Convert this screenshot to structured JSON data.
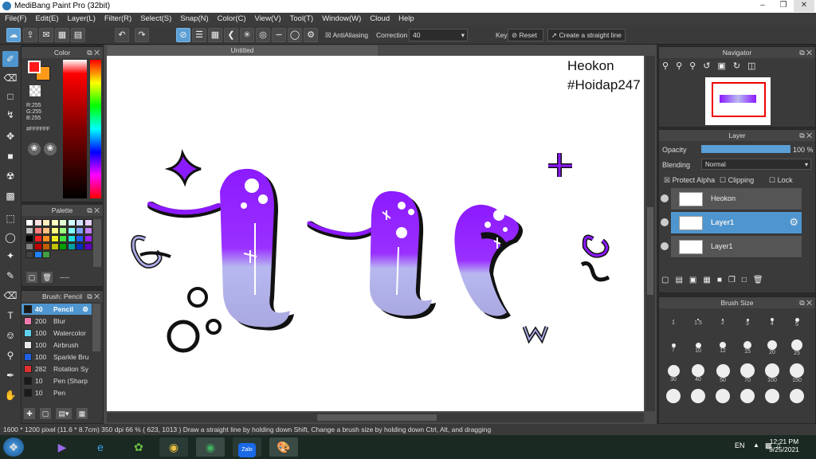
{
  "window": {
    "title": "MediBang Paint Pro (32bit)"
  },
  "menu": [
    "File(F)",
    "Edit(E)",
    "Layer(L)",
    "Filter(R)",
    "Select(S)",
    "Snap(N)",
    "Color(C)",
    "View(V)",
    "Tool(T)",
    "Window(W)",
    "Cloud",
    "Help"
  ],
  "toolbar": {
    "antialiasing": "AntiAliasing",
    "correction_label": "Correction",
    "correction_value": "40",
    "key_label": "Key",
    "reset_label": "Reset",
    "straight_line_label": "Create a straight line"
  },
  "color_panel": {
    "title": "Color",
    "r": "R:255",
    "g": "G:255",
    "b": "B:255",
    "hex": "#FFFFFF",
    "fg": "#ff1a1a",
    "bg": "#ff9a1a"
  },
  "palette_panel": {
    "title": "Palette",
    "page": "----"
  },
  "brush_panel": {
    "title": "Brush: Pencil",
    "items": [
      {
        "num": "40",
        "name": "Pencil",
        "color": "#1a1a1a"
      },
      {
        "num": "200",
        "name": "Blur",
        "color": "#f07ab0"
      },
      {
        "num": "100",
        "name": "Watercolor",
        "color": "#5fd0f0"
      },
      {
        "num": "100",
        "name": "Airbrush",
        "color": "#e8e8e8"
      },
      {
        "num": "100",
        "name": "Sparkle Bru",
        "color": "#2060e0"
      },
      {
        "num": "282",
        "name": "Rotation Sy",
        "color": "#e03030"
      },
      {
        "num": "10",
        "name": "Pen (Sharp",
        "color": "#1a1a1a"
      },
      {
        "num": "10",
        "name": "Pen",
        "color": "#1a1a1a"
      }
    ]
  },
  "document": {
    "tab": "Untitled",
    "watermark1": "Heokon",
    "watermark2": "#Hoidap247"
  },
  "navigator": {
    "title": "Navigator"
  },
  "layer_panel": {
    "title": "Layer",
    "opacity_label": "Opacity",
    "opacity_value": "100 %",
    "opacity": 1.0,
    "blending_label": "Blending",
    "blending_value": "Normal",
    "protect_alpha": "Protect Alpha",
    "clipping": "Clipping",
    "lock": "Lock",
    "layers": [
      {
        "name": "Heokon"
      },
      {
        "name": "Layer1"
      },
      {
        "name": "Layer1"
      }
    ]
  },
  "brush_size": {
    "title": "Brush Size",
    "sizes": [
      "1",
      "1.5",
      "2",
      "3",
      "4",
      "5",
      "7",
      "10",
      "12",
      "15",
      "20",
      "25",
      "30",
      "40",
      "50",
      "70",
      "100",
      "150"
    ]
  },
  "status": "1600 * 1200 pixel  (11.6 * 8.7cm)  350 dpi  66 %  ( 623, 1013 )  Draw a straight line by holding down Shift, Change a brush size by holding down Ctrl, Alt, and dragging",
  "taskbar": {
    "lang": "EN",
    "time": "12:21 PM",
    "date": "9/25/2021",
    "zalo": "Zalo"
  },
  "colors": {
    "accent": "#4f96d0",
    "purple": "#8c1aff",
    "lavender": "#a9a8e0"
  }
}
